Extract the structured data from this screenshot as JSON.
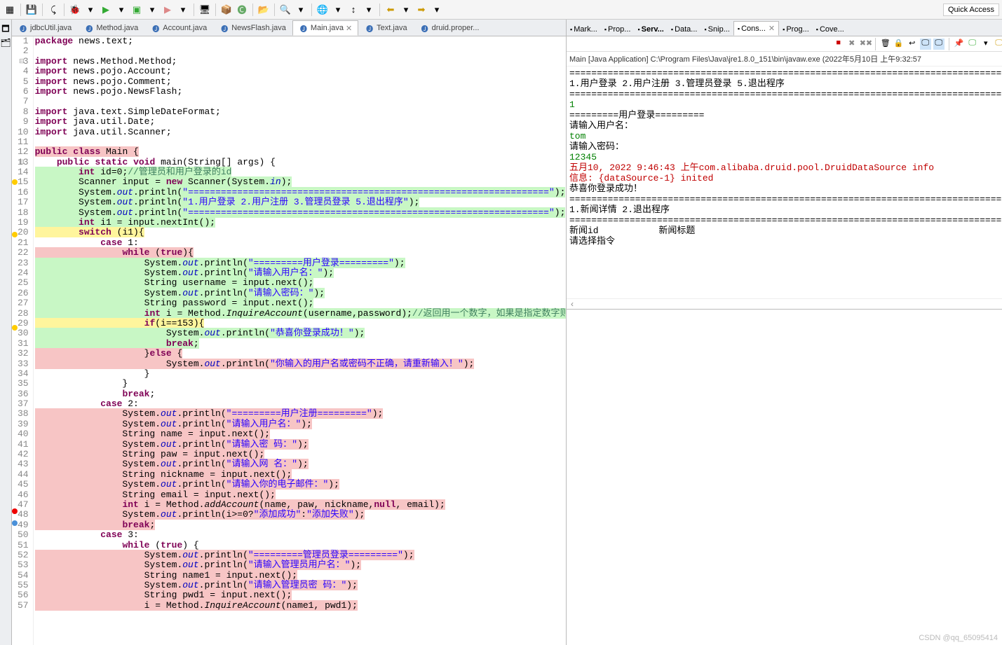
{
  "quick_access": "Quick Access",
  "editor_tabs": [
    {
      "label": "jdbcUtil.java",
      "active": false
    },
    {
      "label": "Method.java",
      "active": false
    },
    {
      "label": "Account.java",
      "active": false
    },
    {
      "label": "NewsFlash.java",
      "active": false
    },
    {
      "label": "Main.java",
      "active": true
    },
    {
      "label": "Text.java",
      "active": false
    },
    {
      "label": "druid.proper...",
      "active": false
    }
  ],
  "right_tabs": [
    {
      "label": "Mark...",
      "active": false
    },
    {
      "label": "Prop...",
      "active": false
    },
    {
      "label": "Serv...",
      "active": false,
      "bold": true
    },
    {
      "label": "Data...",
      "active": false
    },
    {
      "label": "Snip...",
      "active": false
    },
    {
      "label": "Cons...",
      "active": true
    },
    {
      "label": "Prog...",
      "active": false
    },
    {
      "label": "Cove...",
      "active": false
    }
  ],
  "console_header": "Main [Java Application] C:\\Program Files\\Java\\jre1.8.0_151\\bin\\javaw.exe (2022年5月10日 上午9:32:57",
  "console_lines": [
    {
      "t": "==================================================================================",
      "c": ""
    },
    {
      "t": "1.用户登录 2.用户注册 3.管理员登录 5.退出程序",
      "c": ""
    },
    {
      "t": "==================================================================================",
      "c": ""
    },
    {
      "t": "1",
      "c": "con-green"
    },
    {
      "t": "=========用户登录=========",
      "c": ""
    },
    {
      "t": "请输入用户名：",
      "c": ""
    },
    {
      "t": "tom",
      "c": "con-green"
    },
    {
      "t": "请输入密码：",
      "c": ""
    },
    {
      "t": "12345",
      "c": "con-green"
    },
    {
      "t": "五月10, 2022 9:46:43 上午com.alibaba.druid.pool.DruidDataSource info",
      "c": "con-red"
    },
    {
      "t": "信息: {dataSource-1} inited",
      "c": "con-red"
    },
    {
      "t": "恭喜你登录成功！",
      "c": ""
    },
    {
      "t": "==================================================================================",
      "c": ""
    },
    {
      "t": "1.新闻详情 2.退出程序",
      "c": ""
    },
    {
      "t": "==================================================================================",
      "c": ""
    },
    {
      "t": "新闻id           新闻标题",
      "c": ""
    },
    {
      "t": "请选择指令",
      "c": ""
    }
  ],
  "code": [
    {
      "n": 1,
      "hl": "",
      "mk": "",
      "html": "<span class='kw'>package</span> news.text;"
    },
    {
      "n": 2,
      "hl": "",
      "mk": "",
      "html": ""
    },
    {
      "n": 3,
      "hl": "",
      "mk": "fold",
      "html": "<span class='kw'>import</span> news.Method.Method;"
    },
    {
      "n": 4,
      "hl": "",
      "mk": "",
      "html": "<span class='kw'>import</span> news.pojo.Account;"
    },
    {
      "n": 5,
      "hl": "",
      "mk": "",
      "html": "<span class='kw'>import</span> news.pojo.Comment;"
    },
    {
      "n": 6,
      "hl": "",
      "mk": "",
      "html": "<span class='kw'>import</span> news.pojo.NewsFlash;"
    },
    {
      "n": 7,
      "hl": "",
      "mk": "",
      "html": ""
    },
    {
      "n": 8,
      "hl": "",
      "mk": "",
      "html": "<span class='kw'>import</span> java.text.SimpleDateFormat;"
    },
    {
      "n": 9,
      "hl": "",
      "mk": "",
      "html": "<span class='kw'>import</span> java.util.Date;"
    },
    {
      "n": 10,
      "hl": "",
      "mk": "",
      "html": "<span class='kw'>import</span> java.util.Scanner;"
    },
    {
      "n": 11,
      "hl": "",
      "mk": "",
      "html": ""
    },
    {
      "n": 12,
      "hl": "hl-red",
      "mk": "",
      "html": "<span class='kw'>public</span> <span class='kw'>class</span> Main {"
    },
    {
      "n": 13,
      "hl": "",
      "mk": "fold",
      "html": "    <span class='kw'>public</span> <span class='kw'>static</span> <span class='kw'>void</span> main(String[] args) {"
    },
    {
      "n": 14,
      "hl": "hl-green",
      "mk": "",
      "html": "        <span class='kw'>int</span> id=0;<span class='cmt'>//管理员和用户登录的id</span>"
    },
    {
      "n": 15,
      "hl": "hl-green",
      "mk": "warn",
      "html": "        Scanner input = <span class='kw'>new</span> Scanner(System.<span class='fld'>in</span>);"
    },
    {
      "n": 16,
      "hl": "hl-green",
      "mk": "",
      "html": "        System.<span class='fld'>out</span>.println(<span class='str'>\"==================================================================\"</span>);"
    },
    {
      "n": 17,
      "hl": "hl-green",
      "mk": "",
      "html": "        System.<span class='fld'>out</span>.println(<span class='str'>\"1.用户登录 2.用户注册 3.管理员登录 5.退出程序\"</span>);"
    },
    {
      "n": 18,
      "hl": "hl-green",
      "mk": "",
      "html": "        System.<span class='fld'>out</span>.println(<span class='str'>\"==================================================================\"</span>);"
    },
    {
      "n": 19,
      "hl": "hl-green",
      "mk": "",
      "html": "        <span class='kw'>int</span> i1 = input.nextInt();"
    },
    {
      "n": 20,
      "hl": "hl-yellow",
      "mk": "warn",
      "html": "        <span class='kw'>switch</span> (i1){"
    },
    {
      "n": 21,
      "hl": "",
      "mk": "",
      "html": "            <span class='kw'>case</span> 1:"
    },
    {
      "n": 22,
      "hl": "hl-red",
      "mk": "",
      "html": "                <span class='kw'>while</span> (<span class='kw'>true</span>){"
    },
    {
      "n": 23,
      "hl": "hl-green",
      "mk": "",
      "html": "                    System.<span class='fld'>out</span>.println(<span class='str'>\"=========用户登录=========\"</span>);"
    },
    {
      "n": 24,
      "hl": "hl-green",
      "mk": "",
      "html": "                    System.<span class='fld'>out</span>.println(<span class='str'>\"请输入用户名：\"</span>);"
    },
    {
      "n": 25,
      "hl": "hl-green",
      "mk": "",
      "html": "                    String username = input.next();"
    },
    {
      "n": 26,
      "hl": "hl-green",
      "mk": "",
      "html": "                    System.<span class='fld'>out</span>.println(<span class='str'>\"请输入密码：\"</span>);"
    },
    {
      "n": 27,
      "hl": "hl-green",
      "mk": "",
      "html": "                    String password = input.next();"
    },
    {
      "n": 28,
      "hl": "hl-green",
      "mk": "",
      "html": "                    <span class='kw'>int</span> i = Method.<span class='mth'>InquireAccount</span>(username,password);<span class='cmt'>//返回用一个数字，如果是指定数字则登录成功！</span>"
    },
    {
      "n": 29,
      "hl": "hl-yellow",
      "mk": "warn",
      "html": "                    <span class='kw'>if</span>(i==153){"
    },
    {
      "n": 30,
      "hl": "hl-green",
      "mk": "",
      "html": "                        System.<span class='fld'>out</span>.println(<span class='str'>\"恭喜你登录成功！\"</span>);"
    },
    {
      "n": 31,
      "hl": "hl-green",
      "mk": "",
      "html": "                        <span class='kw'>break</span>;"
    },
    {
      "n": 32,
      "hl": "hl-red",
      "mk": "",
      "html": "                    }<span class='kw'>else</span> {"
    },
    {
      "n": 33,
      "hl": "hl-red",
      "mk": "",
      "html": "                        System.<span class='fld'>out</span>.println(<span class='str'>\"你输入的用户名或密码不正确，请重新输入！\"</span>);"
    },
    {
      "n": 34,
      "hl": "",
      "mk": "",
      "html": "                    }"
    },
    {
      "n": 35,
      "hl": "",
      "mk": "",
      "html": "                }"
    },
    {
      "n": 36,
      "hl": "",
      "mk": "",
      "html": "                <span class='kw'>break</span>;"
    },
    {
      "n": 37,
      "hl": "",
      "mk": "",
      "html": "            <span class='kw'>case</span> 2:"
    },
    {
      "n": 38,
      "hl": "hl-redbar",
      "mk": "",
      "html": "                System.<span class='fld'>out</span>.println(<span class='str'>\"=========用户注册=========\"</span>);"
    },
    {
      "n": 39,
      "hl": "hl-redbar",
      "mk": "",
      "html": "                System.<span class='fld'>out</span>.println(<span class='str'>\"请输入用户名：\"</span>);"
    },
    {
      "n": 40,
      "hl": "hl-redbar",
      "mk": "",
      "html": "                String name = input.next();"
    },
    {
      "n": 41,
      "hl": "hl-redbar",
      "mk": "",
      "html": "                System.<span class='fld'>out</span>.println(<span class='str'>\"请输入密 码：\"</span>);"
    },
    {
      "n": 42,
      "hl": "hl-redbar",
      "mk": "",
      "html": "                String paw = input.next();"
    },
    {
      "n": 43,
      "hl": "hl-redbar",
      "mk": "",
      "html": "                System.<span class='fld'>out</span>.println(<span class='str'>\"请输入网 名：\"</span>);"
    },
    {
      "n": 44,
      "hl": "hl-redbar",
      "mk": "",
      "html": "                String nickname = input.next();"
    },
    {
      "n": 45,
      "hl": "hl-redbar",
      "mk": "",
      "html": "                System.<span class='fld'>out</span>.println(<span class='str'>\"请输入你的电子邮件：\"</span>);"
    },
    {
      "n": 46,
      "hl": "hl-redbar",
      "mk": "",
      "html": "                String email = input.next();"
    },
    {
      "n": 47,
      "hl": "hl-redbar",
      "mk": "err",
      "html": "                <span class='kw'>int</span> i = Method.<span class='mth'>addAccount</span>(name, paw, nickname,<span class='kw'>null</span>, email);"
    },
    {
      "n": 48,
      "hl": "hl-redbar",
      "mk": "bp",
      "html": "                System.<span class='fld'>out</span>.println(i>=0?<span class='str'>\"添加成功\"</span>:<span class='str'>\"添加失败\"</span>);"
    },
    {
      "n": 49,
      "hl": "hl-redbar",
      "mk": "",
      "html": "                <span class='kw'>break</span>;"
    },
    {
      "n": 50,
      "hl": "",
      "mk": "",
      "html": "            <span class='kw'>case</span> 3:"
    },
    {
      "n": 51,
      "hl": "",
      "mk": "",
      "html": "                <span class='kw'>while</span> (<span class='kw'>true</span>) {"
    },
    {
      "n": 52,
      "hl": "hl-redbar",
      "mk": "",
      "html": "                    System.<span class='fld'>out</span>.println(<span class='str'>\"=========管理员登录=========\"</span>);"
    },
    {
      "n": 53,
      "hl": "hl-redbar",
      "mk": "",
      "html": "                    System.<span class='fld'>out</span>.println(<span class='str'>\"请输入管理员用户名：\"</span>);"
    },
    {
      "n": 54,
      "hl": "hl-redbar",
      "mk": "",
      "html": "                    String name1 = input.next();"
    },
    {
      "n": 55,
      "hl": "hl-redbar",
      "mk": "",
      "html": "                    System.<span class='fld'>out</span>.println(<span class='str'>\"请输入管理员密 码：\"</span>);"
    },
    {
      "n": 56,
      "hl": "hl-redbar",
      "mk": "",
      "html": "                    String pwd1 = input.next();"
    },
    {
      "n": 57,
      "hl": "hl-redbar",
      "mk": "",
      "html": "                    i = Method.<span class='mth'>InquireAccount</span>(name1, pwd1);"
    }
  ],
  "watermark": "CSDN @qq_65095414"
}
